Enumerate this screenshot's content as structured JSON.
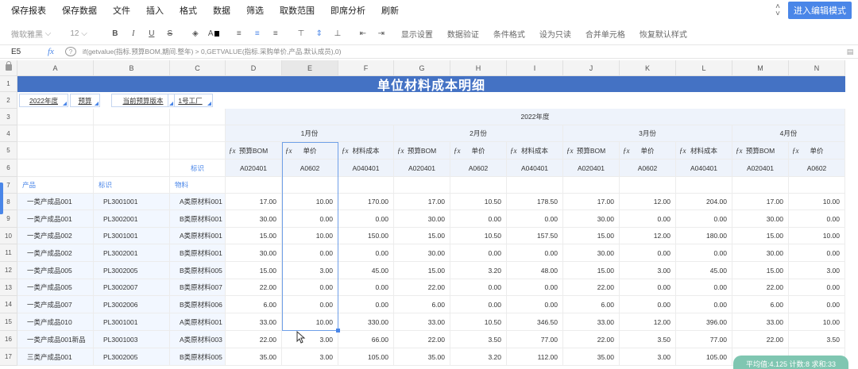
{
  "menu": [
    "保存报表",
    "保存数据",
    "文件",
    "插入",
    "格式",
    "数据",
    "筛选",
    "取数范围",
    "即席分析",
    "刷新"
  ],
  "enter_edit_label": "进入编辑模式",
  "toolbar": {
    "font_name": "微软雅黑",
    "font_size": "12",
    "actions": [
      "显示设置",
      "数据验证",
      "条件格式",
      "设为只读",
      "合并单元格",
      "恢复默认样式"
    ]
  },
  "formula": {
    "cell_ref": "E5",
    "fx": "fx",
    "text": "if(getvalue(指标.预算BOM,期间.整年) > 0,GETVALUE(指标.采购单价,产品.默认成员),0)"
  },
  "columns": [
    "A",
    "B",
    "C",
    "D",
    "E",
    "F",
    "G",
    "H",
    "I",
    "J",
    "K",
    "L",
    "M",
    "N"
  ],
  "rows": [
    "1",
    "2",
    "3",
    "4",
    "5",
    "6",
    "7",
    "8",
    "9",
    "10",
    "11",
    "12",
    "13",
    "14",
    "15",
    "16",
    "17"
  ],
  "report_title": "单位材料成本明细",
  "params": [
    "2022年度",
    "预算",
    "当前预算版本",
    "1号工厂"
  ],
  "year_label": "2022年度",
  "months": [
    "1月份",
    "2月份",
    "3月份",
    "4月份"
  ],
  "measure_headers": [
    "预算BOM",
    "单价",
    "材料成本",
    "预算BOM",
    "单价",
    "材料成本",
    "预算BOM",
    "单价",
    "材料成本",
    "预算BOM",
    "单价"
  ],
  "row6_label": "标识",
  "row6_codes": [
    "A020401",
    "A0602",
    "A040401",
    "A020401",
    "A0602",
    "A040401",
    "A020401",
    "A0602",
    "A040401",
    "A020401",
    "A0602"
  ],
  "row7_labels": [
    "产品",
    "标识",
    "物料"
  ],
  "data_rows": [
    {
      "product": "一类产成品001",
      "id": "PL3001001",
      "material": "A类原材料001",
      "values": [
        "17.00",
        "10.00",
        "170.00",
        "17.00",
        "10.50",
        "178.50",
        "17.00",
        "12.00",
        "204.00",
        "17.00",
        "10.00"
      ]
    },
    {
      "product": "一类产成品001",
      "id": "PL3002001",
      "material": "B类原材料001",
      "values": [
        "30.00",
        "0.00",
        "0.00",
        "30.00",
        "0.00",
        "0.00",
        "30.00",
        "0.00",
        "0.00",
        "30.00",
        "0.00"
      ]
    },
    {
      "product": "一类产成品002",
      "id": "PL3001001",
      "material": "A类原材料001",
      "values": [
        "15.00",
        "10.00",
        "150.00",
        "15.00",
        "10.50",
        "157.50",
        "15.00",
        "12.00",
        "180.00",
        "15.00",
        "10.00"
      ]
    },
    {
      "product": "一类产成品002",
      "id": "PL3002001",
      "material": "B类原材料001",
      "values": [
        "30.00",
        "0.00",
        "0.00",
        "30.00",
        "0.00",
        "0.00",
        "30.00",
        "0.00",
        "0.00",
        "30.00",
        "0.00"
      ]
    },
    {
      "product": "一类产成品005",
      "id": "PL3002005",
      "material": "B类原材料005",
      "values": [
        "15.00",
        "3.00",
        "45.00",
        "15.00",
        "3.20",
        "48.00",
        "15.00",
        "3.00",
        "45.00",
        "15.00",
        "3.00"
      ]
    },
    {
      "product": "一类产成品005",
      "id": "PL3002007",
      "material": "B类原材料007",
      "values": [
        "22.00",
        "0.00",
        "0.00",
        "22.00",
        "0.00",
        "0.00",
        "22.00",
        "0.00",
        "0.00",
        "22.00",
        "0.00"
      ]
    },
    {
      "product": "一类产成品007",
      "id": "PL3002006",
      "material": "B类原材料006",
      "values": [
        "6.00",
        "0.00",
        "0.00",
        "6.00",
        "0.00",
        "0.00",
        "6.00",
        "0.00",
        "0.00",
        "6.00",
        "0.00"
      ]
    },
    {
      "product": "一类产成品010",
      "id": "PL3001001",
      "material": "A类原材料001",
      "values": [
        "33.00",
        "10.00",
        "330.00",
        "33.00",
        "10.50",
        "346.50",
        "33.00",
        "12.00",
        "396.00",
        "33.00",
        "10.00"
      ]
    },
    {
      "product": "一类产成品001新品",
      "id": "PL3001003",
      "material": "A类原材料003",
      "values": [
        "22.00",
        "3.00",
        "66.00",
        "22.00",
        "3.50",
        "77.00",
        "22.00",
        "3.50",
        "77.00",
        "22.00",
        "3.50"
      ]
    },
    {
      "product": "三类产成品001",
      "id": "PL3002005",
      "material": "B类原材料005",
      "values": [
        "35.00",
        "3.00",
        "105.00",
        "35.00",
        "3.20",
        "112.00",
        "35.00",
        "3.00",
        "105.00",
        "",
        ""
      ]
    }
  ],
  "status_text": "平均值:4.125 计数:8 求和:33",
  "colors": {
    "accent": "#4a86e8",
    "title_bg": "#4472c4",
    "status": "#7fc6b1"
  }
}
